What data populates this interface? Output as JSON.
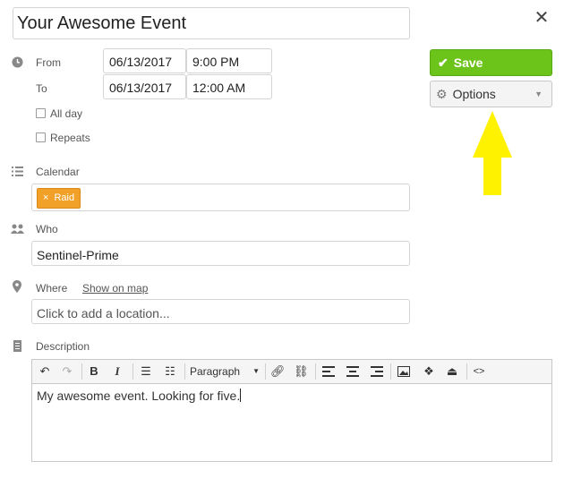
{
  "event": {
    "title": "Your Awesome Event",
    "close_glyph": "✕"
  },
  "datetime": {
    "from_label": "From",
    "to_label": "To",
    "from_date": "06/13/2017",
    "from_time": "9:00 PM",
    "to_date": "06/13/2017",
    "to_time": "12:00 AM",
    "all_day_label": "All day",
    "all_day_checked": false,
    "repeats_label": "Repeats",
    "repeats_checked": false
  },
  "actions": {
    "save_label": "Save",
    "options_label": "Options"
  },
  "calendar": {
    "label": "Calendar",
    "tag_remove": "×",
    "tag_label": "Raid",
    "tag_color": "#f2a128"
  },
  "who": {
    "label": "Who",
    "value": "Sentinel-Prime"
  },
  "where": {
    "label": "Where",
    "show_on_map": "Show on map",
    "placeholder": "Click to add a location..."
  },
  "description": {
    "label": "Description",
    "format_select": "Paragraph",
    "text": "My awesome event.  Looking for five."
  },
  "colors": {
    "save_green": "#6cc31a",
    "annotation_arrow": "#fff200"
  },
  "icons": [
    "clock-icon",
    "list-icon",
    "people-icon",
    "map-pin-icon",
    "document-icon",
    "check-icon",
    "gear-icon",
    "caret-down-icon",
    "close-icon"
  ]
}
